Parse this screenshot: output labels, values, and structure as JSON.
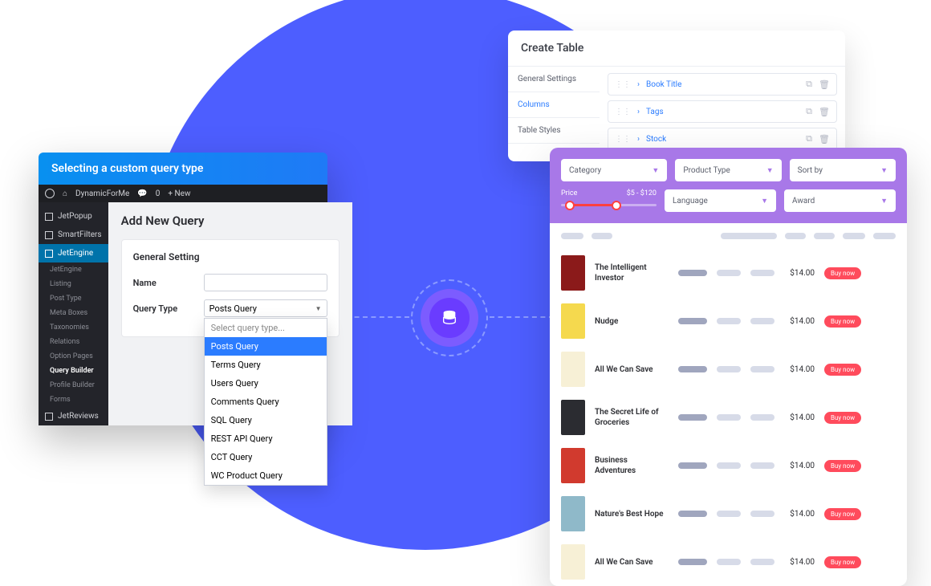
{
  "left": {
    "banner": "Selecting a custom query type",
    "wp_site": "DynamicForMe",
    "wp_comments": "0",
    "wp_new": "+ New",
    "nav": {
      "jetpopup": "JetPopup",
      "smartfilters": "SmartFilters",
      "jetengine": "JetEngine",
      "subs": [
        "JetEngine",
        "Listing",
        "Post Type",
        "Meta Boxes",
        "Taxonomies",
        "Relations",
        "Option Pages",
        "Query Builder",
        "Profile Builder",
        "Forms"
      ],
      "jetreviews": "JetReviews"
    },
    "heading": "Add New Query",
    "card_title": "General Setting",
    "name_label": "Name",
    "name_value": "",
    "qtype_label": "Query Type",
    "qtype_value": "Posts Query",
    "dropdown": {
      "placeholder": "Select query type...",
      "options": [
        "Posts Query",
        "Terms Query",
        "Users Query",
        "Comments Query",
        "SQL Query",
        "REST API Query",
        "CCT Query",
        "WC Product Query"
      ]
    }
  },
  "create_table": {
    "title": "Create Table",
    "tabs": [
      "General Settings",
      "Columns",
      "Table Styles"
    ],
    "active_tab": 1,
    "columns": [
      "Book Title",
      "Tags",
      "Stock"
    ]
  },
  "filters": {
    "category": "Category",
    "product_type": "Product Type",
    "sort_by": "Sort by",
    "price_label": "Price",
    "price_range": "$5 - $120",
    "language": "Language",
    "award": "Award"
  },
  "products": {
    "buy_label": "Buy now",
    "rows": [
      {
        "title": "The Intelligent Investor",
        "price": "$14.00",
        "cover": "#8b1a1a"
      },
      {
        "title": "Nudge",
        "price": "$14.00",
        "cover": "#f5d94e"
      },
      {
        "title": "All We Can Save",
        "price": "$14.00",
        "cover": "#f7f0d6"
      },
      {
        "title": "The Secret Life of Groceries",
        "price": "$14.00",
        "cover": "#2b2c31"
      },
      {
        "title": "Business Adventures",
        "price": "$14.00",
        "cover": "#d13a2e"
      },
      {
        "title": "Nature's Best Hope",
        "price": "$14.00",
        "cover": "#8fb9c9"
      },
      {
        "title": "All We Can Save",
        "price": "$14.00",
        "cover": "#f7f0d6"
      }
    ]
  }
}
